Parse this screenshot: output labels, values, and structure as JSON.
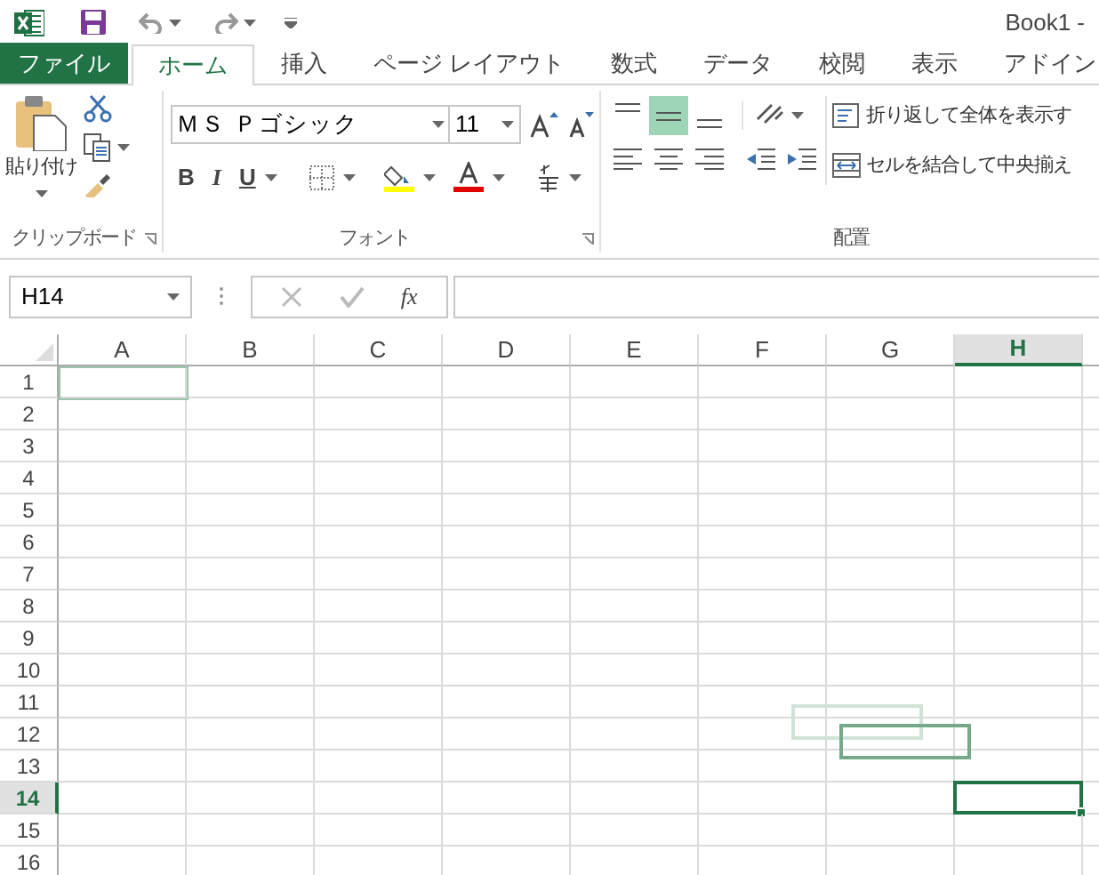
{
  "window": {
    "title": "Book1 -"
  },
  "tabs": [
    {
      "label": "ファイル",
      "kind": "file",
      "selected": false
    },
    {
      "label": "ホーム",
      "kind": "tab",
      "selected": true
    },
    {
      "label": "挿入",
      "kind": "tab",
      "selected": false
    },
    {
      "label": "ページ レイアウト",
      "kind": "tab",
      "selected": false
    },
    {
      "label": "数式",
      "kind": "tab",
      "selected": false
    },
    {
      "label": "データ",
      "kind": "tab",
      "selected": false
    },
    {
      "label": "校閲",
      "kind": "tab",
      "selected": false
    },
    {
      "label": "表示",
      "kind": "tab",
      "selected": false
    },
    {
      "label": "アドイン",
      "kind": "tab",
      "selected": false
    }
  ],
  "ribbon": {
    "clipboard": {
      "label": "クリップボード",
      "paste": "貼り付け"
    },
    "font": {
      "label": "フォント",
      "font_name": "ＭＳ Ｐゴシック",
      "font_size": "11",
      "bold": "B",
      "italic": "I",
      "underline": "U"
    },
    "alignment": {
      "label": "配置",
      "vertical_align": [
        {
          "selected": false
        },
        {
          "selected": true
        },
        {
          "selected": false
        }
      ],
      "wrap_text": "折り返して全体を表示す",
      "merge_center": "セルを結合して中央揃え"
    }
  },
  "formula_bar": {
    "name_box": "H14",
    "fx": "fx"
  },
  "sheet": {
    "columns": [
      {
        "label": "A",
        "selected": false
      },
      {
        "label": "B",
        "selected": false
      },
      {
        "label": "C",
        "selected": false
      },
      {
        "label": "D",
        "selected": false
      },
      {
        "label": "E",
        "selected": false
      },
      {
        "label": "F",
        "selected": false
      },
      {
        "label": "G",
        "selected": false
      },
      {
        "label": "H",
        "selected": true
      }
    ],
    "rows": [
      {
        "label": "1",
        "selected": false
      },
      {
        "label": "2",
        "selected": false
      },
      {
        "label": "3",
        "selected": false
      },
      {
        "label": "4",
        "selected": false
      },
      {
        "label": "5",
        "selected": false
      },
      {
        "label": "6",
        "selected": false
      },
      {
        "label": "7",
        "selected": false
      },
      {
        "label": "8",
        "selected": false
      },
      {
        "label": "9",
        "selected": false
      },
      {
        "label": "10",
        "selected": false
      },
      {
        "label": "11",
        "selected": false
      },
      {
        "label": "12",
        "selected": false
      },
      {
        "label": "13",
        "selected": false
      },
      {
        "label": "14",
        "selected": true
      },
      {
        "label": "15",
        "selected": false
      },
      {
        "label": "16",
        "selected": false
      }
    ]
  }
}
